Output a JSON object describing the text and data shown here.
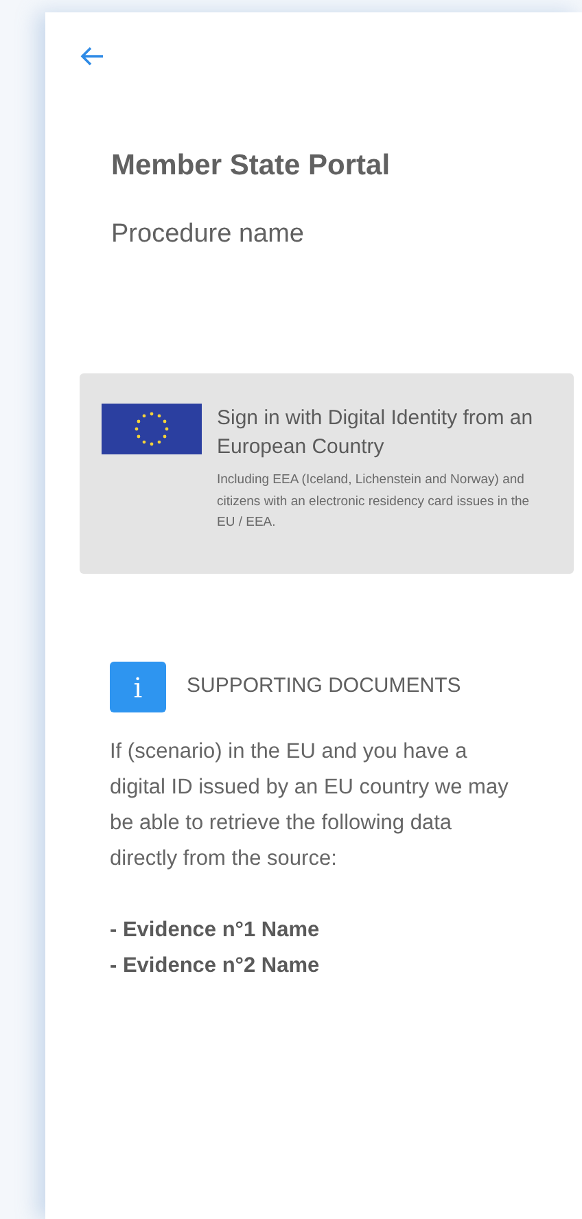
{
  "header": {
    "title": "Member State Portal",
    "subtitle": "Procedure name"
  },
  "sign_in": {
    "title": "Sign in with Digital Identity from an European Country",
    "description": "Including EEA (Iceland, Lichenstein and Norway) and citizens with an electronic residency card issues in the EU / EEA."
  },
  "supporting_documents": {
    "icon": "i",
    "heading": "SUPPORTING DOCUMENTS",
    "text": "If (scenario) in the EU and you have a digital ID issued by an EU country we may be able to retrieve the following data directly from the source:",
    "evidence": [
      "- Evidence n°1 Name",
      "- Evidence n°2 Name"
    ]
  }
}
